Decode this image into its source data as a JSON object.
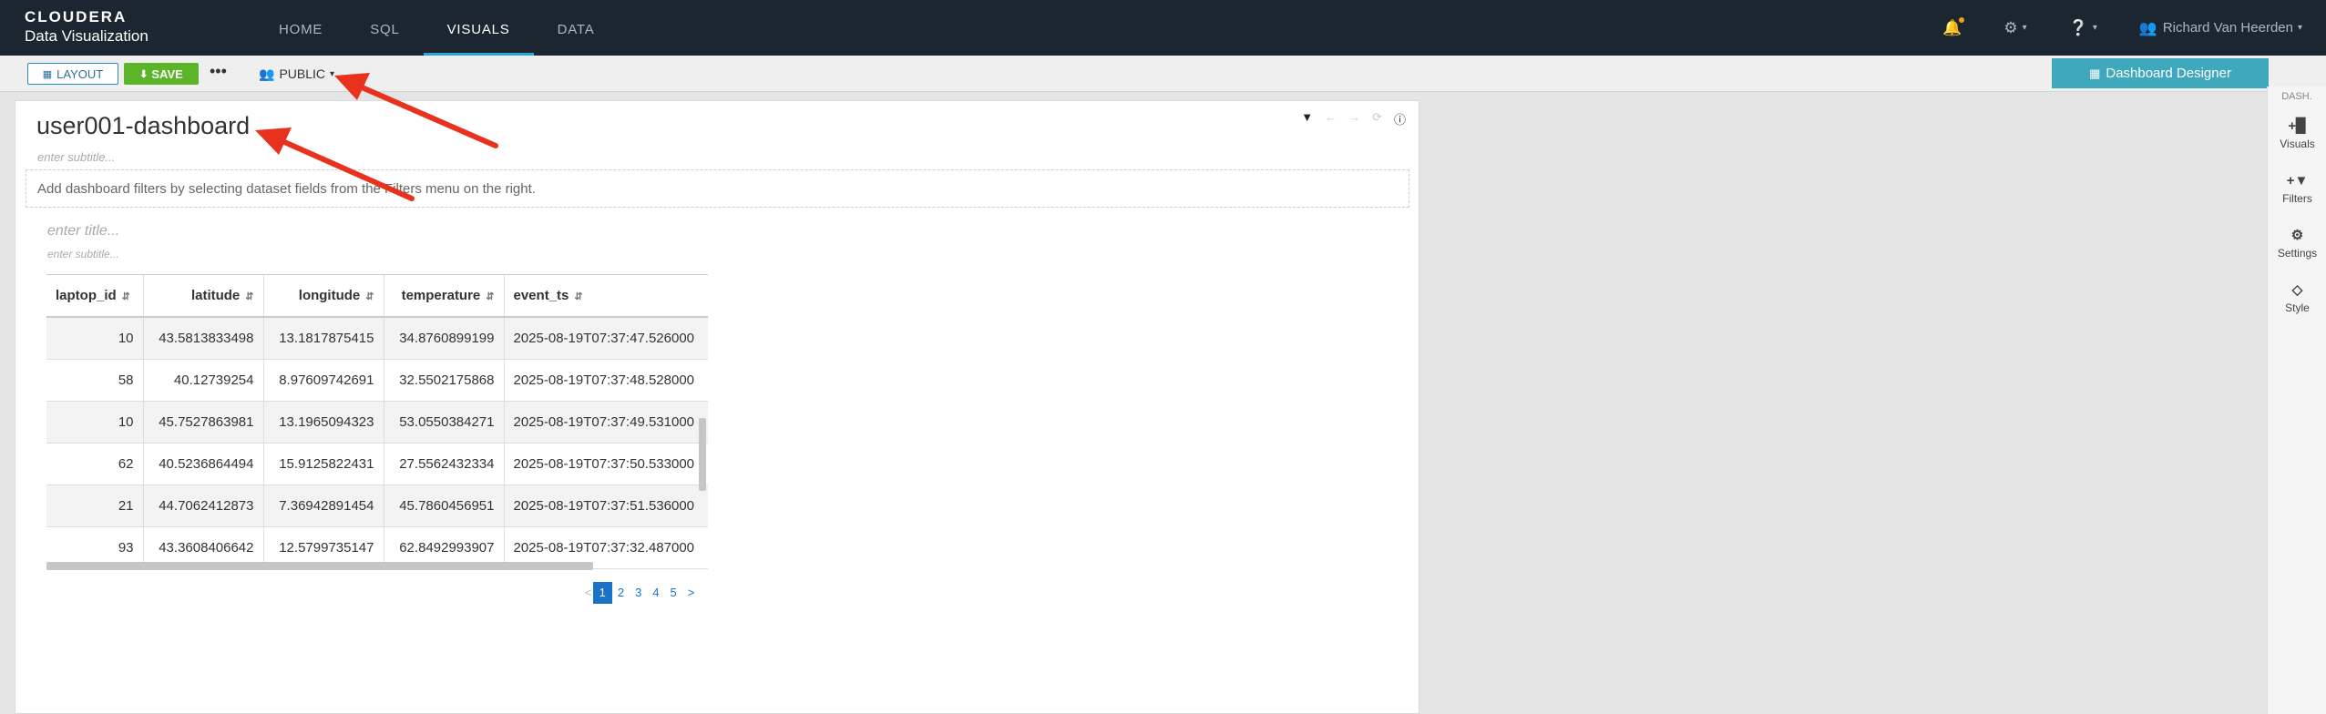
{
  "brand": {
    "line1": "CLOUDERA",
    "line2": "Data Visualization"
  },
  "nav": {
    "items": [
      {
        "label": "HOME"
      },
      {
        "label": "SQL"
      },
      {
        "label": "VISUALS"
      },
      {
        "label": "DATA"
      }
    ],
    "active": "VISUALS",
    "user_name": "Richard Van Heerden",
    "icons": [
      "bell-icon",
      "gear-icon",
      "help-icon",
      "user-icon"
    ]
  },
  "toolbar": {
    "layout_label": "LAYOUT",
    "save_label": "SAVE",
    "more_label": "•••",
    "public_label": "PUBLIC",
    "designer_label": "Dashboard Designer"
  },
  "right_panel": {
    "header": "DASH.",
    "items": [
      {
        "label": "Visuals",
        "icon": "bar-chart-plus-icon"
      },
      {
        "label": "Filters",
        "icon": "filter-plus-icon"
      },
      {
        "label": "Settings",
        "icon": "cogs-icon"
      },
      {
        "label": "Style",
        "icon": "diamond-icon"
      }
    ]
  },
  "dashboard": {
    "title": "user001-dashboard",
    "subtitle_placeholder": "enter subtitle...",
    "filters_hint": "Add dashboard filters by selecting dataset fields from the Filters menu on the right."
  },
  "visual": {
    "title_placeholder": "enter title...",
    "subtitle_placeholder": "enter subtitle...",
    "columns": [
      "laptop_id",
      "latitude",
      "longitude",
      "temperature",
      "event_ts"
    ],
    "rows": [
      [
        "10",
        "43.5813833498",
        "13.1817875415",
        "34.8760899199",
        "2025-08-19T07:37:47.526000"
      ],
      [
        "58",
        "40.12739254",
        "8.97609742691",
        "32.5502175868",
        "2025-08-19T07:37:48.528000"
      ],
      [
        "10",
        "45.7527863981",
        "13.1965094323",
        "53.0550384271",
        "2025-08-19T07:37:49.531000"
      ],
      [
        "62",
        "40.5236864494",
        "15.9125822431",
        "27.5562432334",
        "2025-08-19T07:37:50.533000"
      ],
      [
        "21",
        "44.7062412873",
        "7.36942891454",
        "45.7860456951",
        "2025-08-19T07:37:51.536000"
      ],
      [
        "93",
        "43.3608406642",
        "12.5799735147",
        "62.8492993907",
        "2025-08-19T07:37:32.487000"
      ]
    ],
    "pagination": {
      "prev": "<",
      "pages": [
        "1",
        "2",
        "3",
        "4",
        "5"
      ],
      "current": "1",
      "next": ">"
    }
  },
  "colors": {
    "nav_bg": "#1b2630",
    "accent": "#2ba5d6",
    "save_green": "#5cb528",
    "designer_teal": "#40a8bc",
    "annotation_arrow": "#e8321e"
  }
}
